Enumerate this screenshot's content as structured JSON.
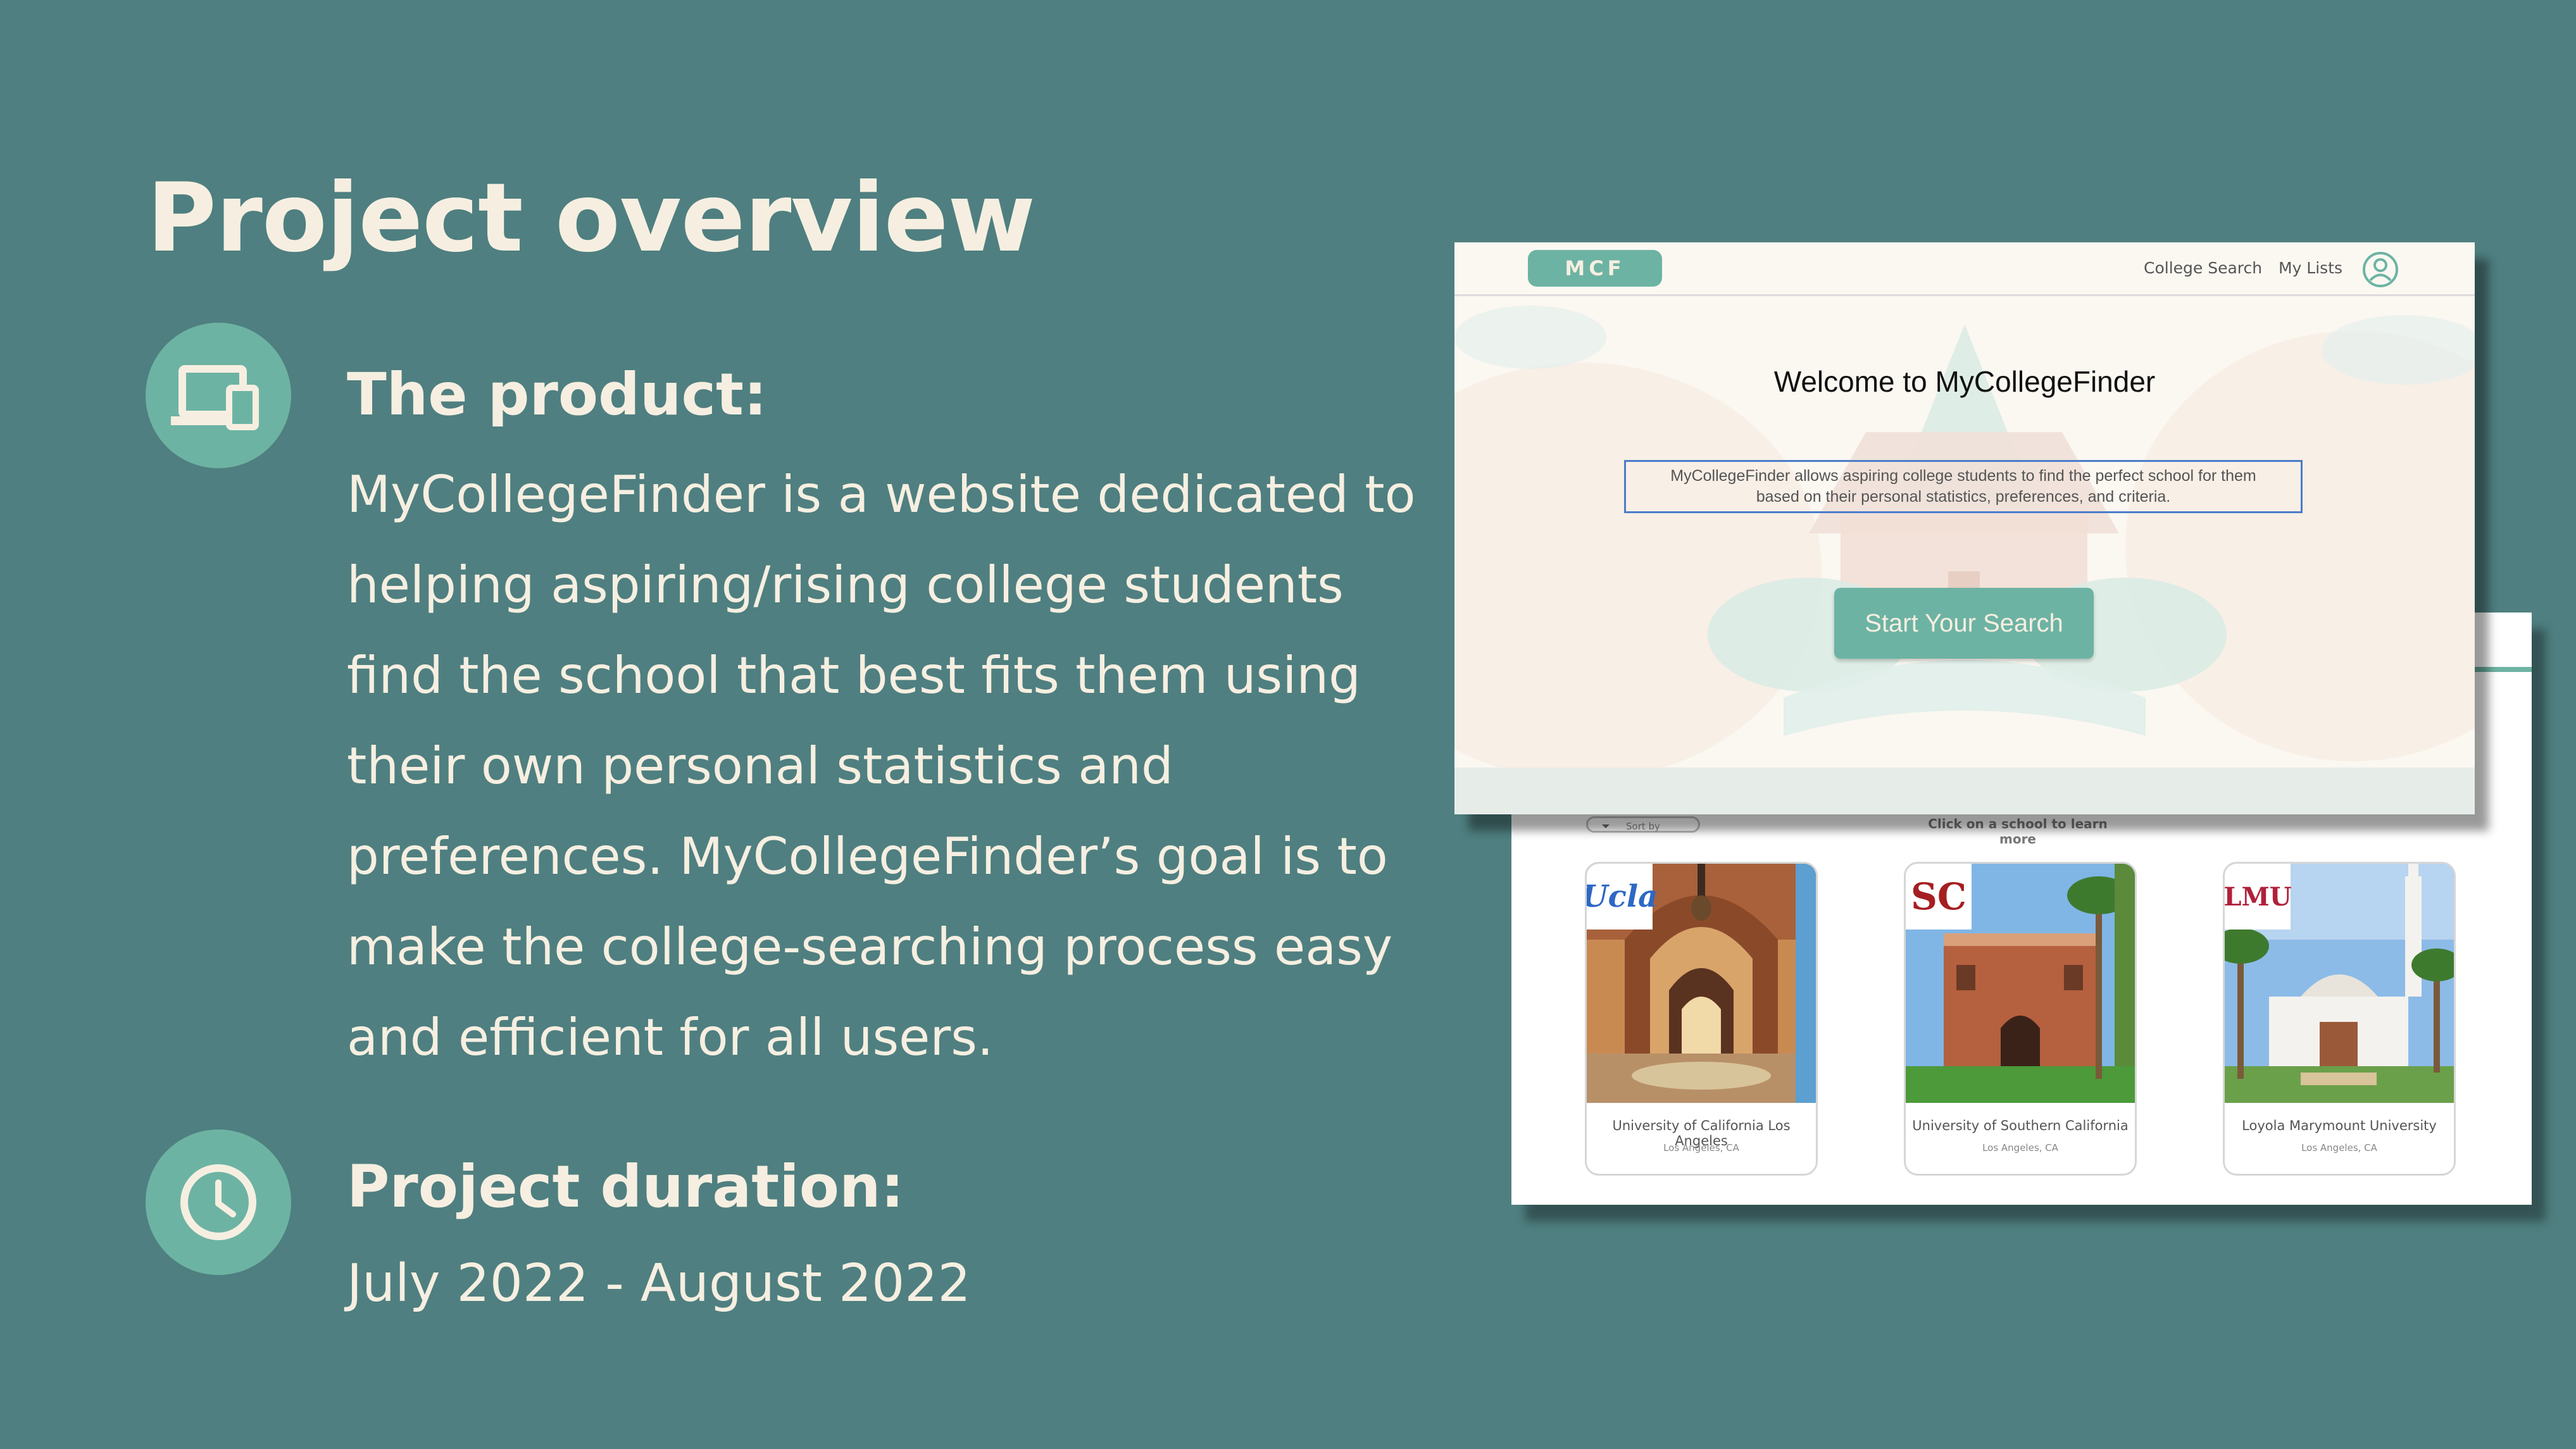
{
  "slide": {
    "title": "Project overview",
    "product_heading": "The product:",
    "product_text": "MyCollegeFinder is a website dedicated to helping aspiring/rising college students find the school that best fits them using their own personal statistics and preferences. MyCollegeFinder’s goal is to make the college-searching process easy and efficient for all users.",
    "duration_heading": "Project duration:",
    "duration_text": "July 2022 - August 2022"
  },
  "icons": {
    "product": "devices-icon",
    "duration": "clock-icon"
  },
  "home_mockup": {
    "brand": "MCF",
    "nav": [
      "College Search",
      "My Lists"
    ],
    "profile_icon": "user-icon",
    "welcome": "Welcome to MyCollegeFinder",
    "intro_line1": "MyCollegeFinder allows aspiring college students to find the perfect school for them",
    "intro_line2": "based on their personal statistics, preferences, and criteria.",
    "cta": "Start Your Search"
  },
  "results_mockup": {
    "sort_label": "Sort by",
    "hint": "Click on a school to learn more",
    "cards": [
      {
        "logo": "Ucla",
        "name": "University of California Los Angeles",
        "location": "Los Angeles, CA"
      },
      {
        "logo": "SC",
        "name": "University of Southern California",
        "location": "Los Angeles, CA"
      },
      {
        "logo": "LMU",
        "name": "Loyola Marymount University",
        "location": "Los Angeles, CA"
      }
    ]
  },
  "colors": {
    "background": "#4f7f80",
    "accent": "#6db3a3",
    "cream": "#f6efe1"
  }
}
